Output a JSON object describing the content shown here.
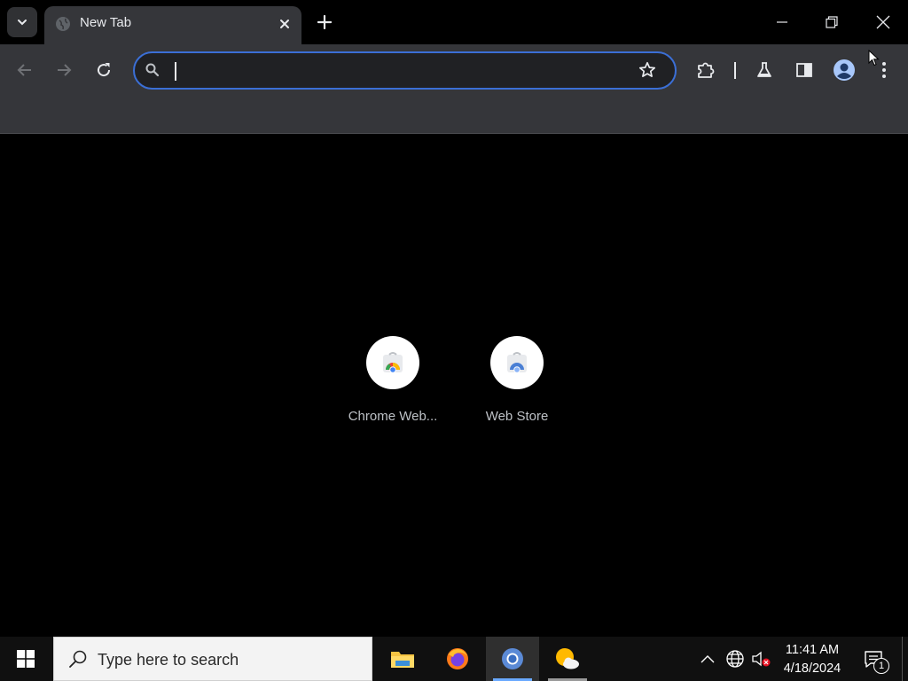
{
  "browser": {
    "tab": {
      "title": "New Tab"
    },
    "omnibox": {
      "value": "",
      "placeholder": ""
    }
  },
  "shortcuts": [
    {
      "label": "Chrome Web..."
    },
    {
      "label": "Web Store"
    }
  ],
  "taskbar": {
    "search_placeholder": "Type here to search",
    "apps": [
      "file-explorer",
      "firefox",
      "chrome",
      "weather"
    ],
    "clock": {
      "time": "11:41 AM",
      "date": "4/18/2024"
    },
    "notification_count": "1"
  },
  "colors": {
    "accent": "#3b6fd6",
    "toolbar": "#35363a",
    "background": "#000000"
  }
}
